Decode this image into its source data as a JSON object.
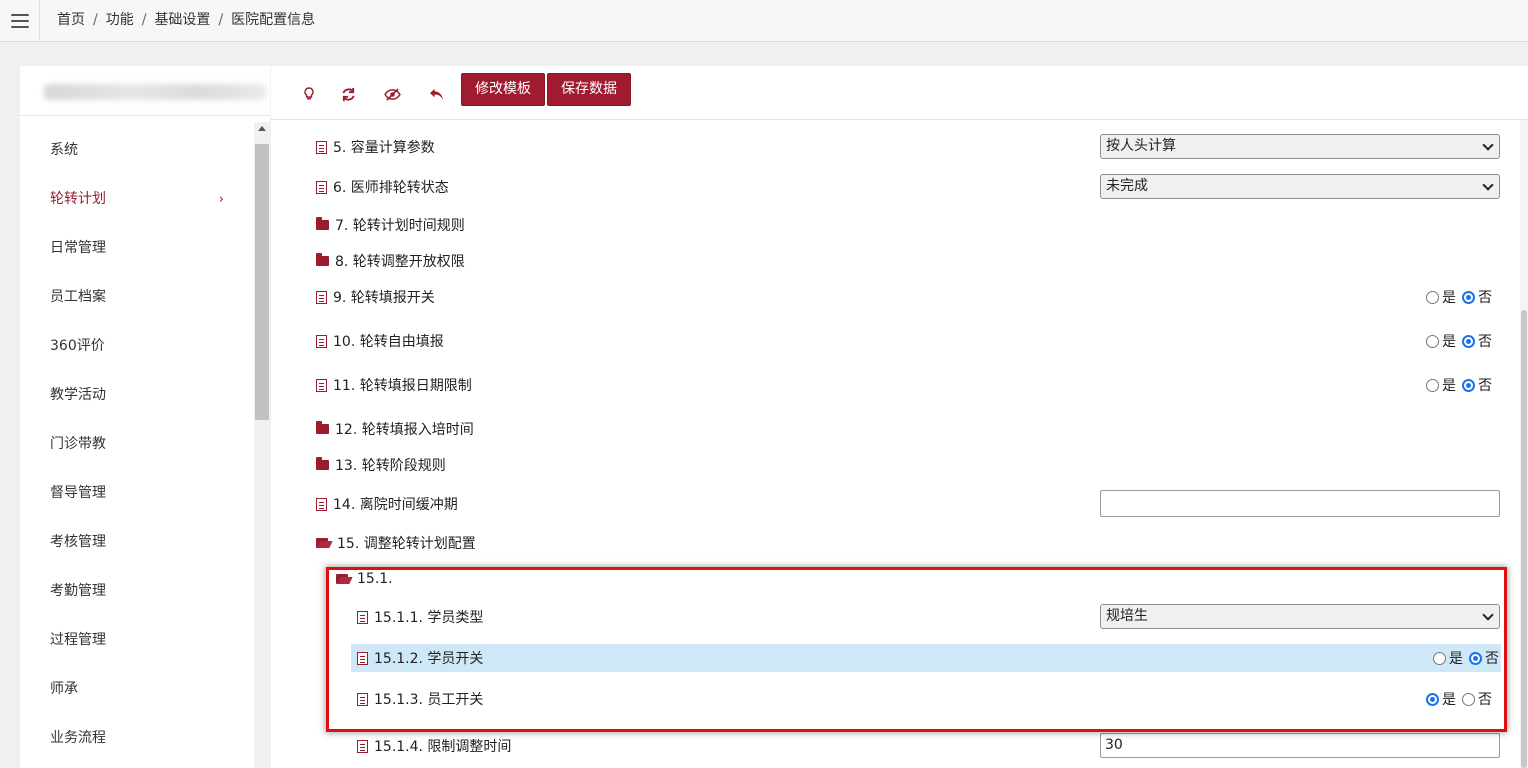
{
  "breadcrumb": [
    "首页",
    "功能",
    "基础设置",
    "医院配置信息"
  ],
  "breadcrumb_sep": "/",
  "sidebar": {
    "items": [
      {
        "label": "系统"
      },
      {
        "label": "轮转计划",
        "active": true
      },
      {
        "label": "日常管理"
      },
      {
        "label": "员工档案"
      },
      {
        "label": "360评价"
      },
      {
        "label": "教学活动"
      },
      {
        "label": "门诊带教"
      },
      {
        "label": "督导管理"
      },
      {
        "label": "考核管理"
      },
      {
        "label": "考勤管理"
      },
      {
        "label": "过程管理"
      },
      {
        "label": "师承"
      },
      {
        "label": "业务流程"
      }
    ],
    "active_chevron": "›"
  },
  "toolbar": {
    "edit_template_label": "修改模板",
    "save_data_label": "保存数据"
  },
  "radio_labels": {
    "yes": "是",
    "no": "否"
  },
  "rows": {
    "r5": {
      "label": "5. 容量计算参数",
      "value": "按人头计算"
    },
    "r6": {
      "label": "6. 医师排轮转状态",
      "value": "未完成"
    },
    "r7": {
      "label": "7. 轮转计划时间规则"
    },
    "r8": {
      "label": "8. 轮转调整开放权限"
    },
    "r9": {
      "label": "9. 轮转填报开关",
      "selected": "否"
    },
    "r10": {
      "label": "10. 轮转自由填报",
      "selected": "否"
    },
    "r11": {
      "label": "11. 轮转填报日期限制",
      "selected": "否"
    },
    "r12": {
      "label": "12. 轮转填报入培时间"
    },
    "r13": {
      "label": "13. 轮转阶段规则"
    },
    "r14": {
      "label": "14. 离院时间缓冲期",
      "value": ""
    },
    "r15": {
      "label": "15. 调整轮转计划配置"
    },
    "r151": {
      "label": "15.1."
    },
    "r1511": {
      "label": "15.1.1. 学员类型",
      "value": "规培生"
    },
    "r1512": {
      "label": "15.1.2. 学员开关",
      "selected": "否"
    },
    "r1513": {
      "label": "15.1.3. 员工开关",
      "selected": "是"
    },
    "r1514": {
      "label": "15.1.4. 限制调整时间",
      "value": "30"
    }
  },
  "colors": {
    "accent": "#a01b30",
    "highlight": "#cfe8f7",
    "annotation": "#e01010",
    "radio": "#1a73e8"
  }
}
